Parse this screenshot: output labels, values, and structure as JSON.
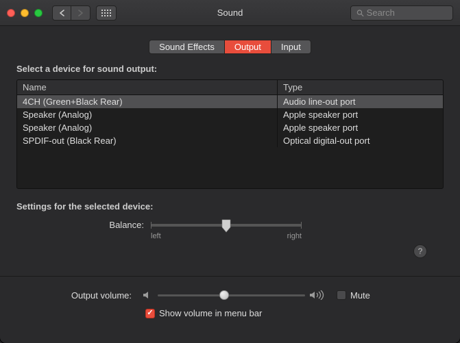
{
  "window": {
    "title": "Sound"
  },
  "search": {
    "placeholder": "Search"
  },
  "tabs": [
    {
      "label": "Sound Effects",
      "active": false
    },
    {
      "label": "Output",
      "active": true
    },
    {
      "label": "Input",
      "active": false
    }
  ],
  "panel": {
    "header": "Select a device for sound output:",
    "columns": {
      "name": "Name",
      "type": "Type"
    },
    "rows": [
      {
        "name": "4CH (Green+Black Rear)",
        "type": "Audio line-out port",
        "selected": true
      },
      {
        "name": "Speaker (Analog)",
        "type": "Apple speaker port",
        "selected": false
      },
      {
        "name": "Speaker (Analog)",
        "type": "Apple speaker port",
        "selected": false
      },
      {
        "name": "SPDIF-out (Black Rear)",
        "type": "Optical digital-out port",
        "selected": false
      }
    ]
  },
  "settings": {
    "header": "Settings for the selected device:",
    "balance": {
      "label": "Balance:",
      "left_label": "left",
      "right_label": "right",
      "value": 0.5
    }
  },
  "help": {
    "label": "?"
  },
  "volume": {
    "label": "Output volume:",
    "value": 0.45,
    "mute": {
      "label": "Mute",
      "checked": false
    }
  },
  "menubar": {
    "label": "Show volume in menu bar",
    "checked": true
  }
}
